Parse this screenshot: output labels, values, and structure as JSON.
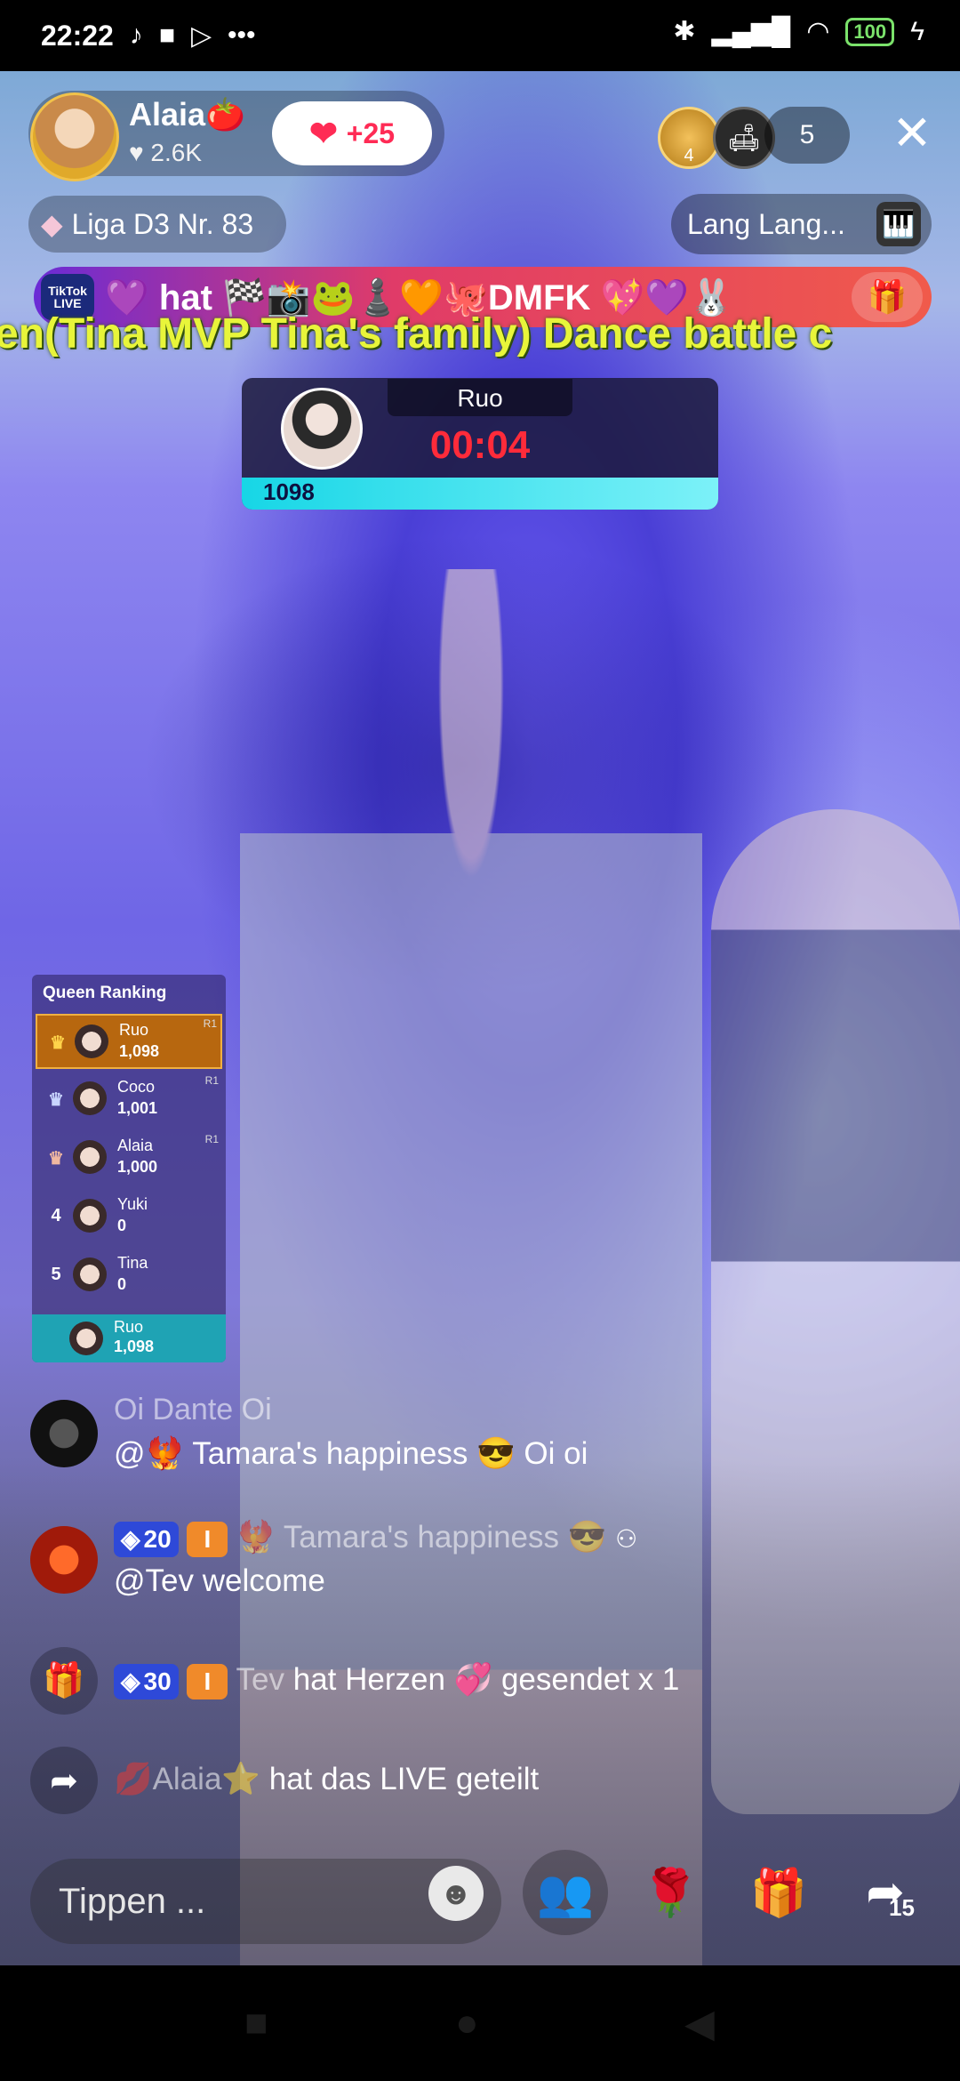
{
  "status_bar": {
    "time": "22:22",
    "battery": "100"
  },
  "host": {
    "name": "Alaia",
    "name_emoji": "🍅",
    "likes": "2.6K",
    "like_button_count": "+25"
  },
  "header": {
    "top_viewer_rank": "4",
    "viewer_count": "5",
    "league": "Liga D3 Nr. 83",
    "music_label": "Lang Lang..."
  },
  "gift_banner": {
    "badge": "TikTok LIVE",
    "text": "💜 hat 🏁📸🐸♟️🧡🐙DMFK 💖💜🐰"
  },
  "marquee": {
    "text": "en(Tina MVP Tina's family) Dance battle c"
  },
  "battle": {
    "name": "Ruo",
    "timer": "00:04",
    "score": "1098"
  },
  "queen_ranking": {
    "title": "Queen Ranking",
    "rows": [
      {
        "rank": "1",
        "name": "Ruo",
        "score": "1,098",
        "tag": "R1"
      },
      {
        "rank": "2",
        "name": "Coco",
        "score": "1,001",
        "tag": "R1"
      },
      {
        "rank": "3",
        "name": "Alaia",
        "score": "1,000",
        "tag": "R1"
      },
      {
        "rank": "4",
        "name": "Yuki",
        "score": "0",
        "tag": ""
      },
      {
        "rank": "5",
        "name": "Tina",
        "score": "0",
        "tag": ""
      }
    ],
    "current": {
      "name": "Ruo",
      "score": "1,098"
    }
  },
  "chat": [
    {
      "user": "Oi Dante Oi",
      "message": "@🐦‍🔥 Tamara's happiness 😎 Oi oi"
    },
    {
      "badge_level": "20",
      "user": "🐦‍🔥 Tamara's happiness 😎",
      "message": "@Tev welcome"
    },
    {
      "badge_level": "30",
      "user": "Tev",
      "message": "hat Herzen 💞 gesendet x 1"
    },
    {
      "user": "💋Alaia⭐",
      "message": "hat das LIVE geteilt"
    }
  ],
  "bottom_bar": {
    "input_placeholder": "Tippen ...",
    "share_count": "15"
  },
  "colors": {
    "accent_red": "#ff2b55",
    "timer_red": "#ff2b3a",
    "battle_bar": "#17d6e6",
    "ranking_gold": "#b7670f"
  },
  "icons": [
    "tiktok-icon",
    "video-icon",
    "play-icon",
    "more-icon",
    "bluetooth-icon",
    "signal-icon",
    "wifi-icon",
    "battery-icon",
    "heart-icon",
    "medal-icon",
    "seat-icon",
    "close-icon",
    "diamond-icon",
    "piano-icon",
    "gift-icon",
    "crown-icon",
    "emoji-icon",
    "guests-icon",
    "rose-icon",
    "share-icon"
  ]
}
